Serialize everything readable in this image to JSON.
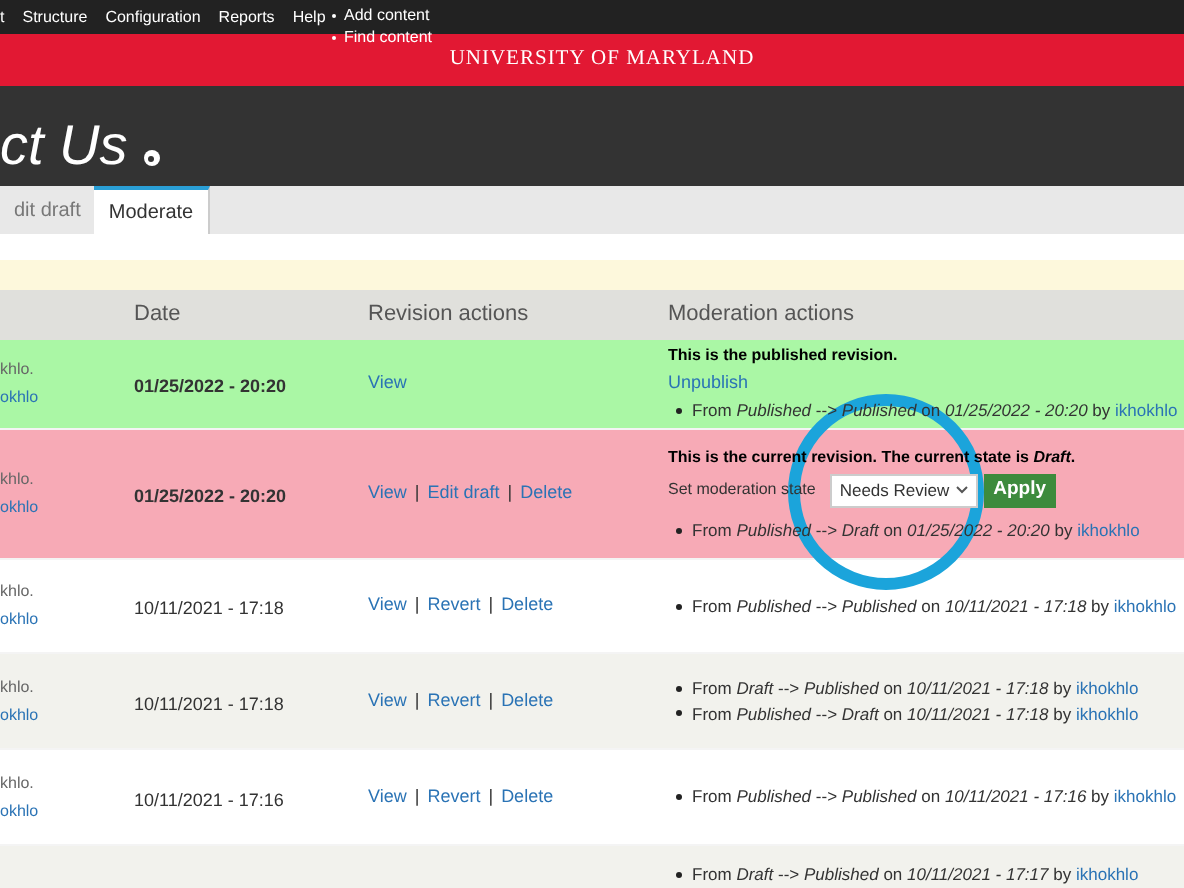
{
  "toolbar": {
    "items": [
      "t",
      "Structure",
      "Configuration",
      "Reports",
      "Help"
    ],
    "dropdown": [
      "Add content",
      "Find content"
    ]
  },
  "banner": "UNIVERSITY OF MARYLAND",
  "action_separator": "|",
  "page_title": "ct Us",
  "tabs": [
    {
      "label": "dit draft",
      "selected": false
    },
    {
      "label": "Moderate",
      "selected": true
    }
  ],
  "table": {
    "columns": [
      "Date",
      "Revision actions",
      "Moderation actions"
    ],
    "rows": [
      {
        "kind": "published",
        "author": [
          "khlo.",
          "okhlo"
        ],
        "date": "01/25/2022 - 20:20",
        "actions": [
          "View"
        ],
        "message": "This is the published revision.",
        "link": "Unpublish",
        "log": [
          {
            "text": "From *Published* --> *Published* on *01/25/2022 - 20:20* by",
            "user": "ikhokhlo"
          }
        ]
      },
      {
        "kind": "current",
        "author": [
          "khlo.",
          "okhlo"
        ],
        "date": "01/25/2022 - 20:20",
        "actions": [
          "View",
          "Edit draft",
          "Delete"
        ],
        "message": "This is the current revision. The current state is *Draft*.",
        "form": {
          "label": "Set moderation state",
          "value": "Needs Review",
          "button": "Apply"
        },
        "log": [
          {
            "text": "From *Published* --> *Draft* on *01/25/2022 - 20:20* by",
            "user": "ikhokhlo"
          }
        ]
      },
      {
        "kind": "history",
        "author": [
          "khlo.",
          "okhlo"
        ],
        "date": "10/11/2021 - 17:18",
        "actions": [
          "View",
          "Revert",
          "Delete"
        ],
        "log": [
          {
            "text": "From *Published* --> *Published* on *10/11/2021 - 17:18* by",
            "user": "ikhokhlo"
          }
        ]
      },
      {
        "kind": "history",
        "author": [
          "khlo.",
          "okhlo"
        ],
        "date": "10/11/2021 - 17:18",
        "actions": [
          "View",
          "Revert",
          "Delete"
        ],
        "log": [
          {
            "text": "From *Draft* --> *Published* on *10/11/2021 - 17:18* by",
            "user": "ikhokhlo"
          },
          {
            "text": "From *Published* --> *Draft* on *10/11/2021 - 17:18* by",
            "user": "ikhokhlo"
          }
        ]
      },
      {
        "kind": "history",
        "author": [
          "khlo.",
          "okhlo"
        ],
        "date": "10/11/2021 - 17:16",
        "actions": [
          "View",
          "Revert",
          "Delete"
        ],
        "log": [
          {
            "text": "From *Published* --> *Published* on *10/11/2021 - 17:16* by",
            "user": "ikhokhlo"
          }
        ]
      },
      {
        "kind": "history",
        "log": [
          {
            "text": "From *Draft* --> *Published* on *10/11/2021 - 17:17* by",
            "user": "ikhokhlo"
          }
        ]
      }
    ]
  }
}
